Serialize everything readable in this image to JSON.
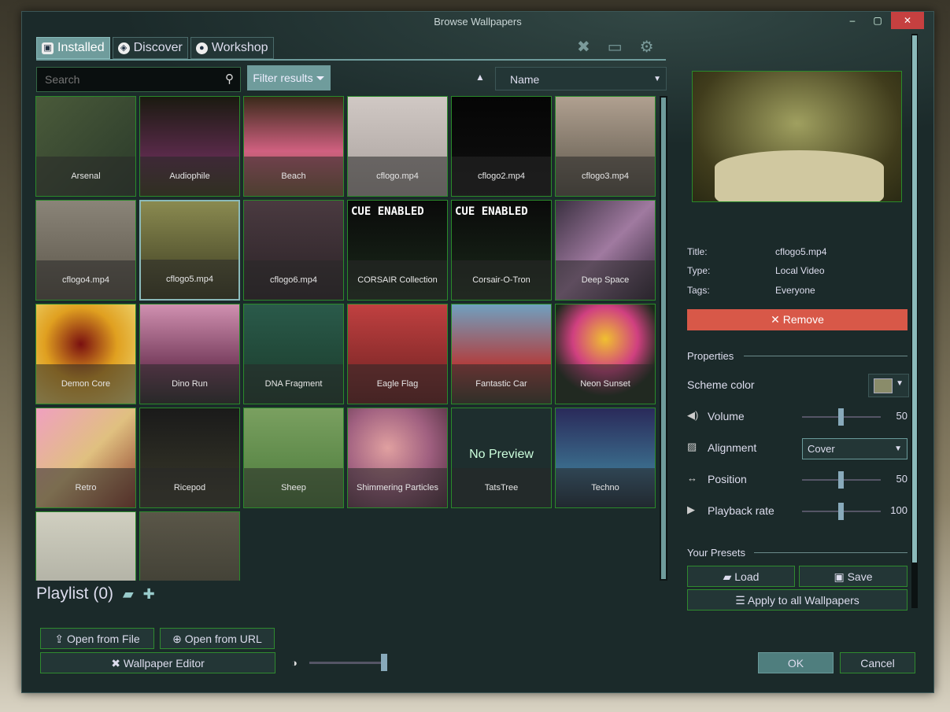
{
  "window": {
    "title": "Browse Wallpapers",
    "controls": [
      "–",
      "▢",
      "✕"
    ]
  },
  "tabs": [
    {
      "label": "Installed",
      "icon": "save-icon",
      "active": true
    },
    {
      "label": "Discover",
      "icon": "compass-icon",
      "active": false
    },
    {
      "label": "Workshop",
      "icon": "steam-icon",
      "active": false
    }
  ],
  "toolbar_icons": [
    "tools-icon",
    "monitor-icon",
    "gear-icon"
  ],
  "search": {
    "placeholder": "Search",
    "value": ""
  },
  "filter_label": "Filter results",
  "sort": {
    "direction": "▲",
    "value": "Name"
  },
  "wallpapers": [
    {
      "name": "Arsenal"
    },
    {
      "name": "Audiophile"
    },
    {
      "name": "Beach"
    },
    {
      "name": "cflogo.mp4"
    },
    {
      "name": "cflogo2.mp4"
    },
    {
      "name": "cflogo3.mp4"
    },
    {
      "name": "cflogo4.mp4"
    },
    {
      "name": "cflogo5.mp4",
      "selected": true
    },
    {
      "name": "cflogo6.mp4"
    },
    {
      "name": "CORSAIR Collection",
      "badge": "CUE ENABLED"
    },
    {
      "name": "Corsair-O-Tron",
      "badge": "CUE ENABLED"
    },
    {
      "name": "Deep Space"
    },
    {
      "name": "Demon Core"
    },
    {
      "name": "Dino Run"
    },
    {
      "name": "DNA Fragment"
    },
    {
      "name": "Eagle Flag"
    },
    {
      "name": "Fantastic Car"
    },
    {
      "name": "Neon Sunset"
    },
    {
      "name": "Retro"
    },
    {
      "name": "Ricepod"
    },
    {
      "name": "Sheep"
    },
    {
      "name": "Shimmering Particles"
    },
    {
      "name": "TatsTree",
      "no_preview": "No Preview"
    },
    {
      "name": "Techno"
    },
    {
      "name": ""
    },
    {
      "name": ""
    }
  ],
  "playlist": {
    "label": "Playlist (0)"
  },
  "buttons": {
    "open_file": "Open from File",
    "open_url": "Open from URL",
    "editor": "Wallpaper Editor",
    "ok": "OK",
    "cancel": "Cancel"
  },
  "details": {
    "title_label": "Title:",
    "title": "cflogo5.mp4",
    "type_label": "Type:",
    "type": "Local Video",
    "tags_label": "Tags:",
    "tags": "Everyone",
    "remove": "Remove"
  },
  "properties": {
    "heading": "Properties",
    "scheme_color_label": "Scheme color",
    "scheme_color": "#8a8c6a",
    "volume_label": "Volume",
    "volume": 50,
    "alignment_label": "Alignment",
    "alignment": "Cover",
    "position_label": "Position",
    "position": 50,
    "playback_label": "Playback rate",
    "playback": 100
  },
  "presets": {
    "heading": "Your Presets",
    "load": "Load",
    "save": "Save",
    "apply_all": "Apply to all Wallpapers"
  },
  "brightness_level": 1.0,
  "colors": {
    "accent": "#6f9c9c",
    "remove": "#d85848",
    "tile_border": "#2a8a2a"
  }
}
